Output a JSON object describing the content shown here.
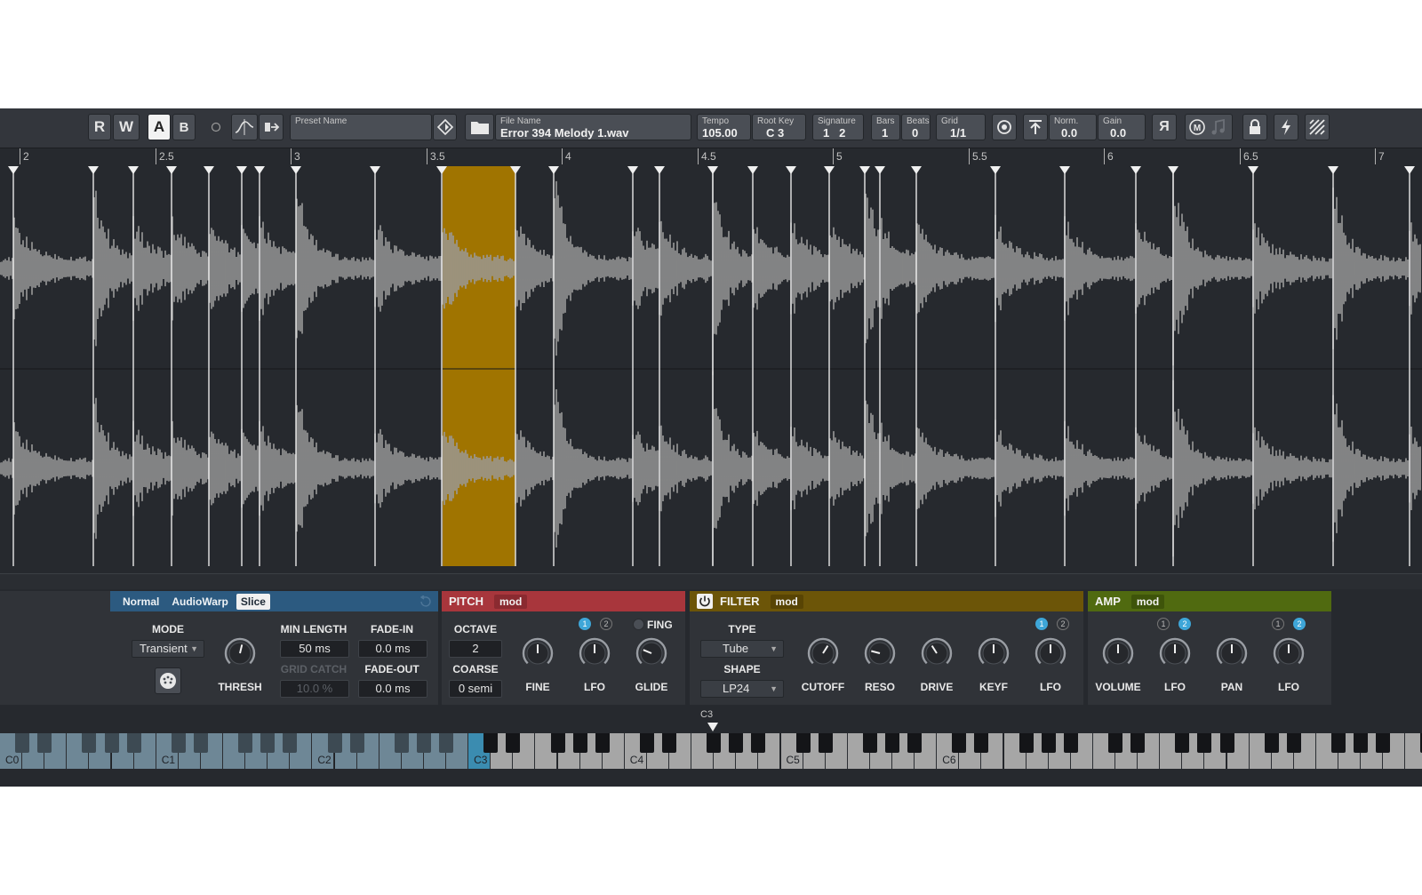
{
  "toolbar": {
    "r_label": "R",
    "w_label": "W",
    "a_label": "A",
    "b_label": "B",
    "preset": {
      "label": "Preset Name",
      "value": ""
    },
    "file": {
      "label": "File Name",
      "value": "Error 394 Melody 1.wav"
    },
    "tempo": {
      "label": "Tempo",
      "value": "105.00"
    },
    "root_key": {
      "label": "Root Key",
      "value": "C 3"
    },
    "signature": {
      "label": "Signature",
      "num": "1",
      "den": "2"
    },
    "bars": {
      "label": "Bars",
      "value": "1"
    },
    "beats": {
      "label": "Beats",
      "value": "0"
    },
    "grid": {
      "label": "Grid",
      "value": "1/1"
    },
    "norm": {
      "label": "Norm.",
      "value": "0.0"
    },
    "gain": {
      "label": "Gain",
      "value": "0.0"
    },
    "reverse_label": "Я",
    "icons": [
      "record-indicator-icon",
      "warp-curve-icon",
      "snap-icon",
      "tag-icon",
      "folder-icon",
      "target-icon",
      "export-icon",
      "midi-icon",
      "note-icon",
      "lock-icon",
      "lightning-icon",
      "hatch-icon"
    ]
  },
  "ruler": {
    "ticks": [
      "2",
      "2.5",
      "3",
      "3.5",
      "4",
      "4.5",
      "5",
      "5.5",
      "6",
      "6.5",
      "7"
    ]
  },
  "waveform": {
    "selected_color": "#a07400",
    "wave_color": "#9a9a9a"
  },
  "slice_panel": {
    "tabs": [
      "Normal",
      "AudioWarp",
      "Slice"
    ],
    "active_tab": "Slice",
    "mode_label": "MODE",
    "mode_value": "Transient",
    "thresh_label": "THRESH",
    "min_length_label": "MIN LENGTH",
    "min_length_value": "50 ms",
    "fade_in_label": "FADE-IN",
    "fade_in_value": "0.0 ms",
    "grid_catch_label": "GRID CATCH",
    "grid_catch_value": "10.0 %",
    "fade_out_label": "FADE-OUT",
    "fade_out_value": "0.0 ms",
    "color": "#2c5a80"
  },
  "pitch_panel": {
    "title": "PITCH",
    "mod_label": "mod",
    "octave_label": "OCTAVE",
    "octave_value": "2",
    "coarse_label": "COARSE",
    "coarse_value": "0 semi",
    "fine_label": "FINE",
    "lfo_label": "LFO",
    "glide_label": "GLIDE",
    "fing_label": "FING",
    "mod1": "1",
    "mod2": "2",
    "color": "#a8363c"
  },
  "filter_panel": {
    "title": "FILTER",
    "mod_label": "mod",
    "type_label": "TYPE",
    "type_value": "Tube",
    "shape_label": "SHAPE",
    "shape_value": "LP24",
    "cutoff_label": "CUTOFF",
    "reso_label": "RESO",
    "drive_label": "DRIVE",
    "keyf_label": "KEYF",
    "lfo_label": "LFO",
    "mod1": "1",
    "mod2": "2",
    "color": "#6c5508"
  },
  "amp_panel": {
    "title": "AMP",
    "mod_label": "mod",
    "volume_label": "VOLUME",
    "lfo1_label": "LFO",
    "pan_label": "PAN",
    "lfo2_label": "LFO",
    "mod1": "1",
    "mod2": "2",
    "color": "#506a10"
  },
  "keyboard": {
    "root_marker": "C3",
    "octave_labels": [
      "C0",
      "C1",
      "C2",
      "C3",
      "C4",
      "C5",
      "C6"
    ],
    "root_color": "#3b8cb0",
    "low_color": "#6e8796",
    "high_color": "#a6a6a6"
  }
}
